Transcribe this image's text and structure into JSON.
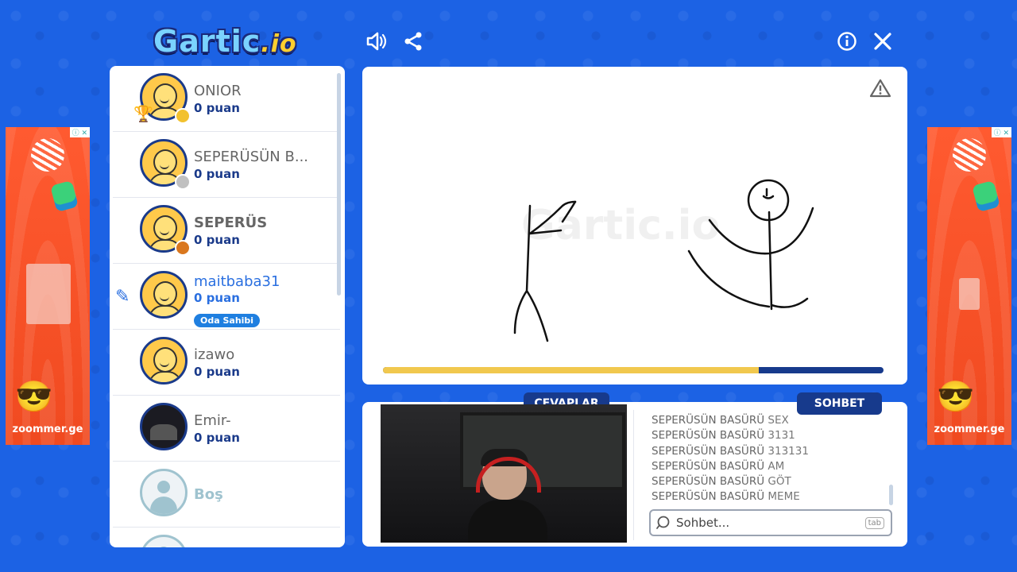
{
  "header": {
    "logo_text": "Gartic",
    "logo_suffix": ".io"
  },
  "players": [
    {
      "name": "ONIOR",
      "score": "0 puan",
      "dot_color": "#f2c12e",
      "rank": "1"
    },
    {
      "name": "SEPERÜSÜN B...",
      "score": "0 puan",
      "dot_color": "#c0c0c0"
    },
    {
      "name": "SEPERÜS",
      "score": "0 puan",
      "dot_color": "#d9771e"
    },
    {
      "name": "maitbaba31",
      "score": "0 puan",
      "badge": "Oda Sahibi",
      "drawing": true
    },
    {
      "name": "izawo",
      "score": "0 puan"
    },
    {
      "name": "Emir-",
      "score": "0 puan"
    },
    {
      "name": "Boş"
    }
  ],
  "canvas": {
    "watermark": "Gartic.io",
    "timer_progress": 0.75
  },
  "tabs": {
    "answers": "CEVAPLAR",
    "chat": "SOHBET"
  },
  "chat": {
    "messages": [
      {
        "user": "SEPERÜSÜN BASÜRÜ",
        "text": "SEX"
      },
      {
        "user": "SEPERÜSÜN BASÜRÜ",
        "text": "3131"
      },
      {
        "user": "SEPERÜSÜN BASÜRÜ",
        "text": "313131"
      },
      {
        "user": "SEPERÜSÜN BASÜRÜ",
        "text": "AM"
      },
      {
        "user": "SEPERÜSÜN BASÜRÜ",
        "text": "GÖT"
      },
      {
        "user": "SEPERÜSÜN BASÜRÜ",
        "text": "MEME"
      }
    ],
    "input_placeholder": "Sohbet...",
    "tab_key": "tab"
  },
  "ads": {
    "brand": "zoommer.ge",
    "info": "ⓘ ✕"
  },
  "colors": {
    "background": "#1c62e4",
    "panel_navy": "#173a8c",
    "accent_yellow": "#f1c84e",
    "ad_orange": "#f04a20"
  }
}
